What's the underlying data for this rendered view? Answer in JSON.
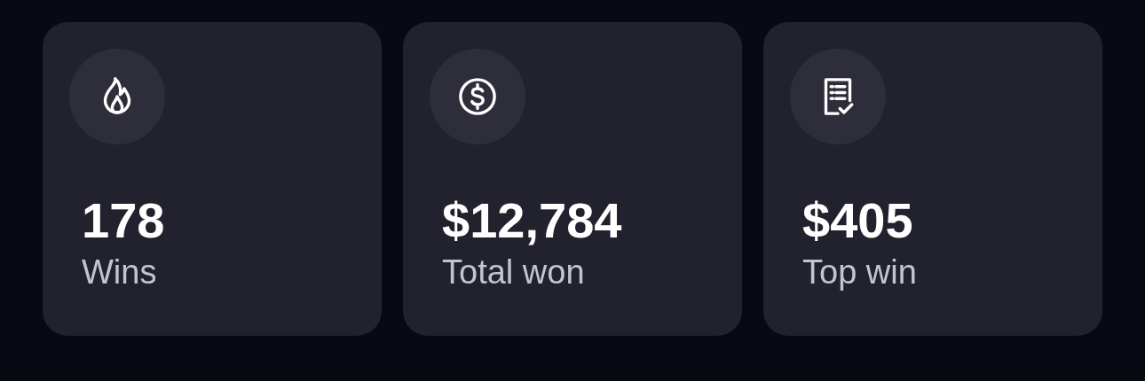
{
  "stats": [
    {
      "value": "178",
      "label": "Wins"
    },
    {
      "value": "$12,784",
      "label": "Total won"
    },
    {
      "value": "$405",
      "label": "Top win"
    }
  ]
}
